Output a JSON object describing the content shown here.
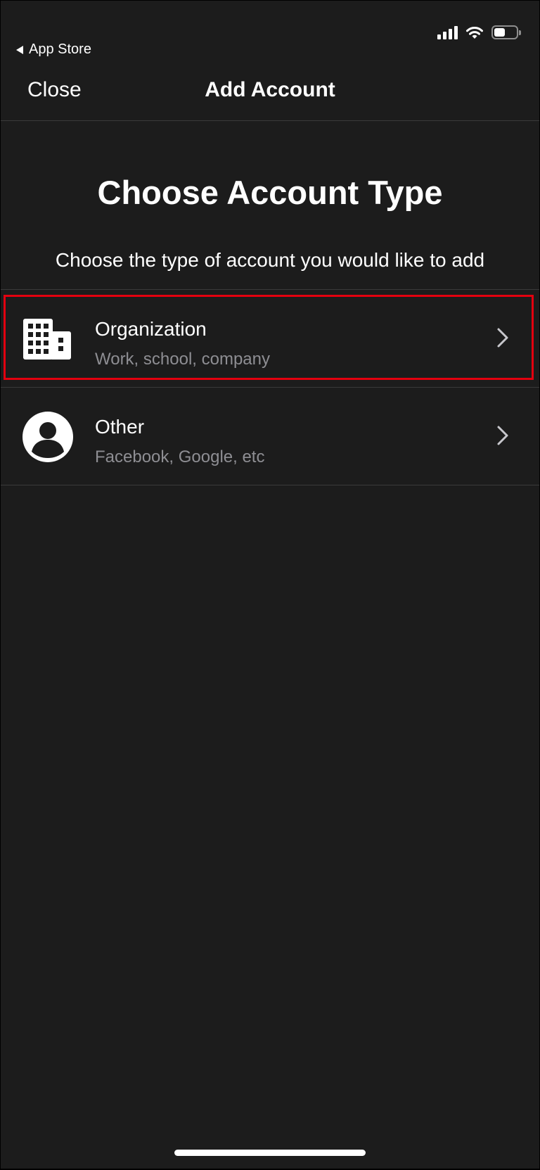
{
  "status_bar": {
    "back_label": "App Store",
    "battery_level": 0.5
  },
  "nav": {
    "close_label": "Close",
    "title": "Add Account"
  },
  "content": {
    "heading": "Choose Account Type",
    "subheading": "Choose the type of account you would like to add"
  },
  "account_types": [
    {
      "title": "Organization",
      "subtitle": "Work, school, company",
      "icon": "building-icon",
      "highlighted": true
    },
    {
      "title": "Other",
      "subtitle": "Facebook, Google, etc",
      "icon": "person-circle-icon",
      "highlighted": false
    }
  ],
  "colors": {
    "background": "#1c1c1c",
    "text": "#ffffff",
    "secondary_text": "#8e8e93",
    "separator": "#3a3a3a",
    "highlight_border": "#e3000f"
  }
}
